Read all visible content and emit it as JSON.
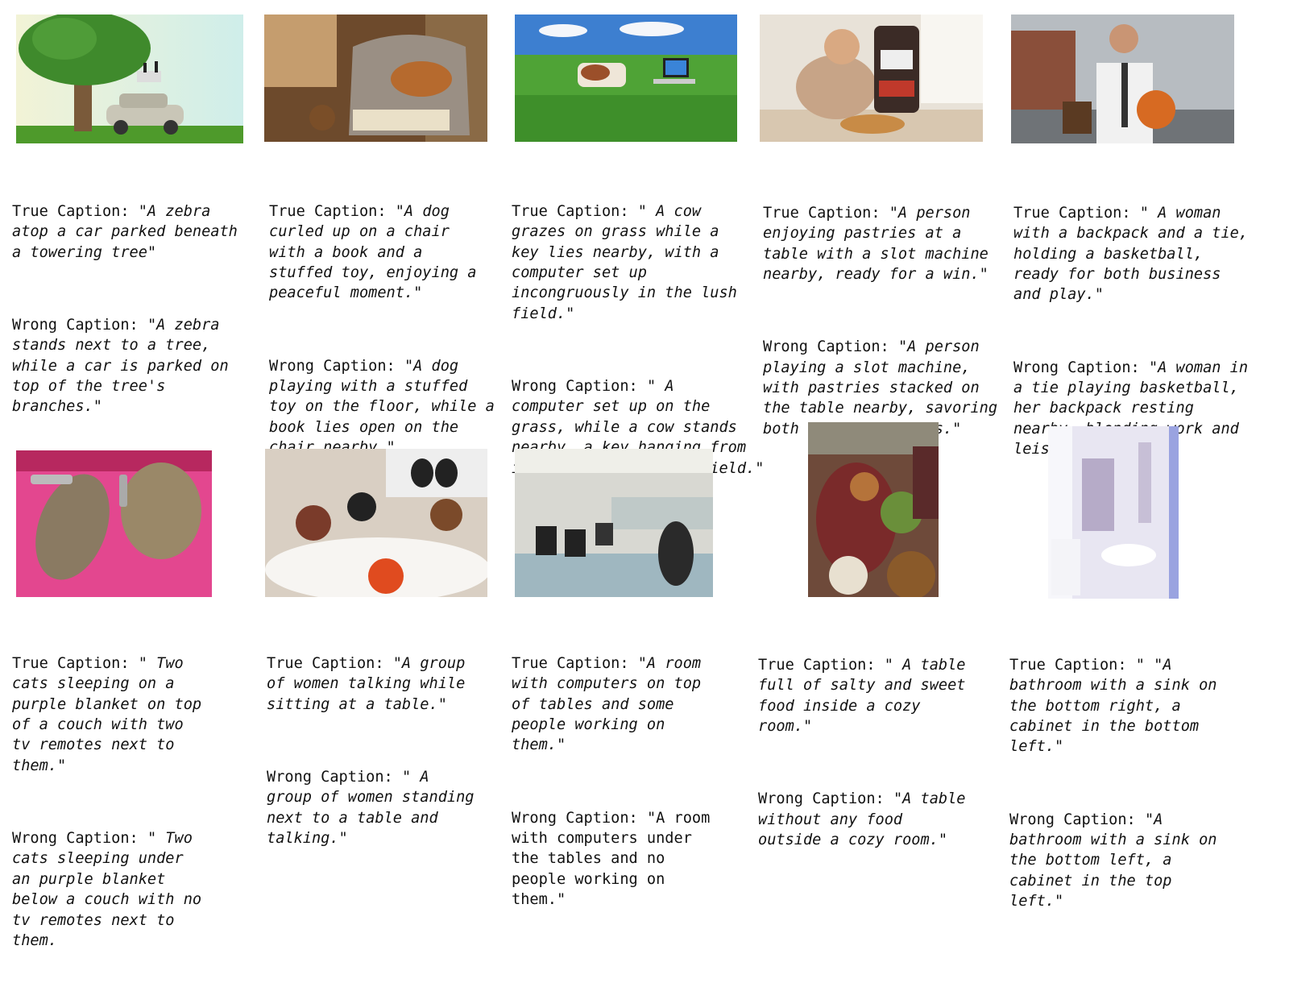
{
  "figure": {
    "items": [
      {
        "true_label": "True Caption:",
        "true_text": "\"A zebra\natop a car parked beneath\na towering tree\"",
        "wrong_label": "Wrong Caption:",
        "wrong_text": "\"A zebra\nstands next to a tree,\nwhile a car is parked on\ntop of the tree's\nbranches.\""
      },
      {
        "true_label": "True Caption:",
        "true_text": "\"A dog\ncurled up on a chair\nwith a book and a\nstuffed toy, enjoying a\npeaceful moment.\"",
        "wrong_label": "Wrong Caption:",
        "wrong_text": "\"A dog\nplaying with a stuffed\ntoy on the floor, while a\nbook lies open on the\nchair nearby.\""
      },
      {
        "true_label": "True Caption:",
        "true_text": "\" A cow\ngrazes on grass while a\nkey lies nearby, with a\ncomputer set up\nincongruously in the lush\nfield.\"",
        "wrong_label": "Wrong Caption:",
        "wrong_text": "\" A\ncomputer set up on the\ngrass, while a cow stands\nnearby, a key hanging from\nits neck in the open field.\""
      },
      {
        "true_label": "True Caption:",
        "true_text": "\"A person\nenjoying pastries at a\ntable with a slot machine\nnearby, ready for a win.\"",
        "wrong_label": "Wrong Caption:",
        "wrong_text": "\"A person\nplaying a slot machine,\nwith pastries stacked on\nthe table nearby, savoring\nboth luck and treats.\""
      },
      {
        "true_label": "True Caption:",
        "true_text": "\" A woman\nwith a backpack and a tie,\nholding a basketball,\nready for both business\nand play.\"",
        "wrong_label": "Wrong Caption:",
        "wrong_text": "\"A woman in\na tie playing basketball,\nher backpack resting\nnearby, blending work and\nleisure.\""
      },
      {
        "true_label": "True Caption:",
        "true_text": "\" Two\ncats sleeping on a\npurple blanket on top\nof a couch with two\ntv remotes next to\nthem.\"",
        "wrong_label": "Wrong Caption:",
        "wrong_text": "\" Two\ncats sleeping under\nan purple blanket\nbelow a couch with no\ntv remotes next to\nthem."
      },
      {
        "true_label": "True Caption:",
        "true_text": "\"A group\nof women talking while\nsitting at a table.\"",
        "wrong_label": "Wrong Caption:",
        "wrong_text": "\" A\ngroup of women standing\nnext to a table and\ntalking.\""
      },
      {
        "true_label": "True Caption:",
        "true_text": "\"A room\nwith computers on top\nof tables and some\npeople working on\nthem.\"",
        "wrong_label": "Wrong Caption:",
        "wrong_text": "\"A room\nwith computers under\nthe tables and no\npeople working on\nthem.\"",
        "wrong_upright": true
      },
      {
        "true_label": "True Caption:",
        "true_text": "\" A table\nfull of salty and sweet\nfood inside a cozy\nroom.\"",
        "wrong_label": "Wrong Caption:",
        "wrong_text": "\"A table\nwithout any food\noutside a cozy room.\""
      },
      {
        "true_label": "True Caption:",
        "true_text": "\" \"A\nbathroom with a sink on\nthe bottom right, a\ncabinet in the bottom\nleft.\"",
        "wrong_label": "Wrong Caption:",
        "wrong_text": "\"A\nbathroom with a sink on\nthe bottom left, a\ncabinet in the top\nleft.\""
      }
    ]
  }
}
